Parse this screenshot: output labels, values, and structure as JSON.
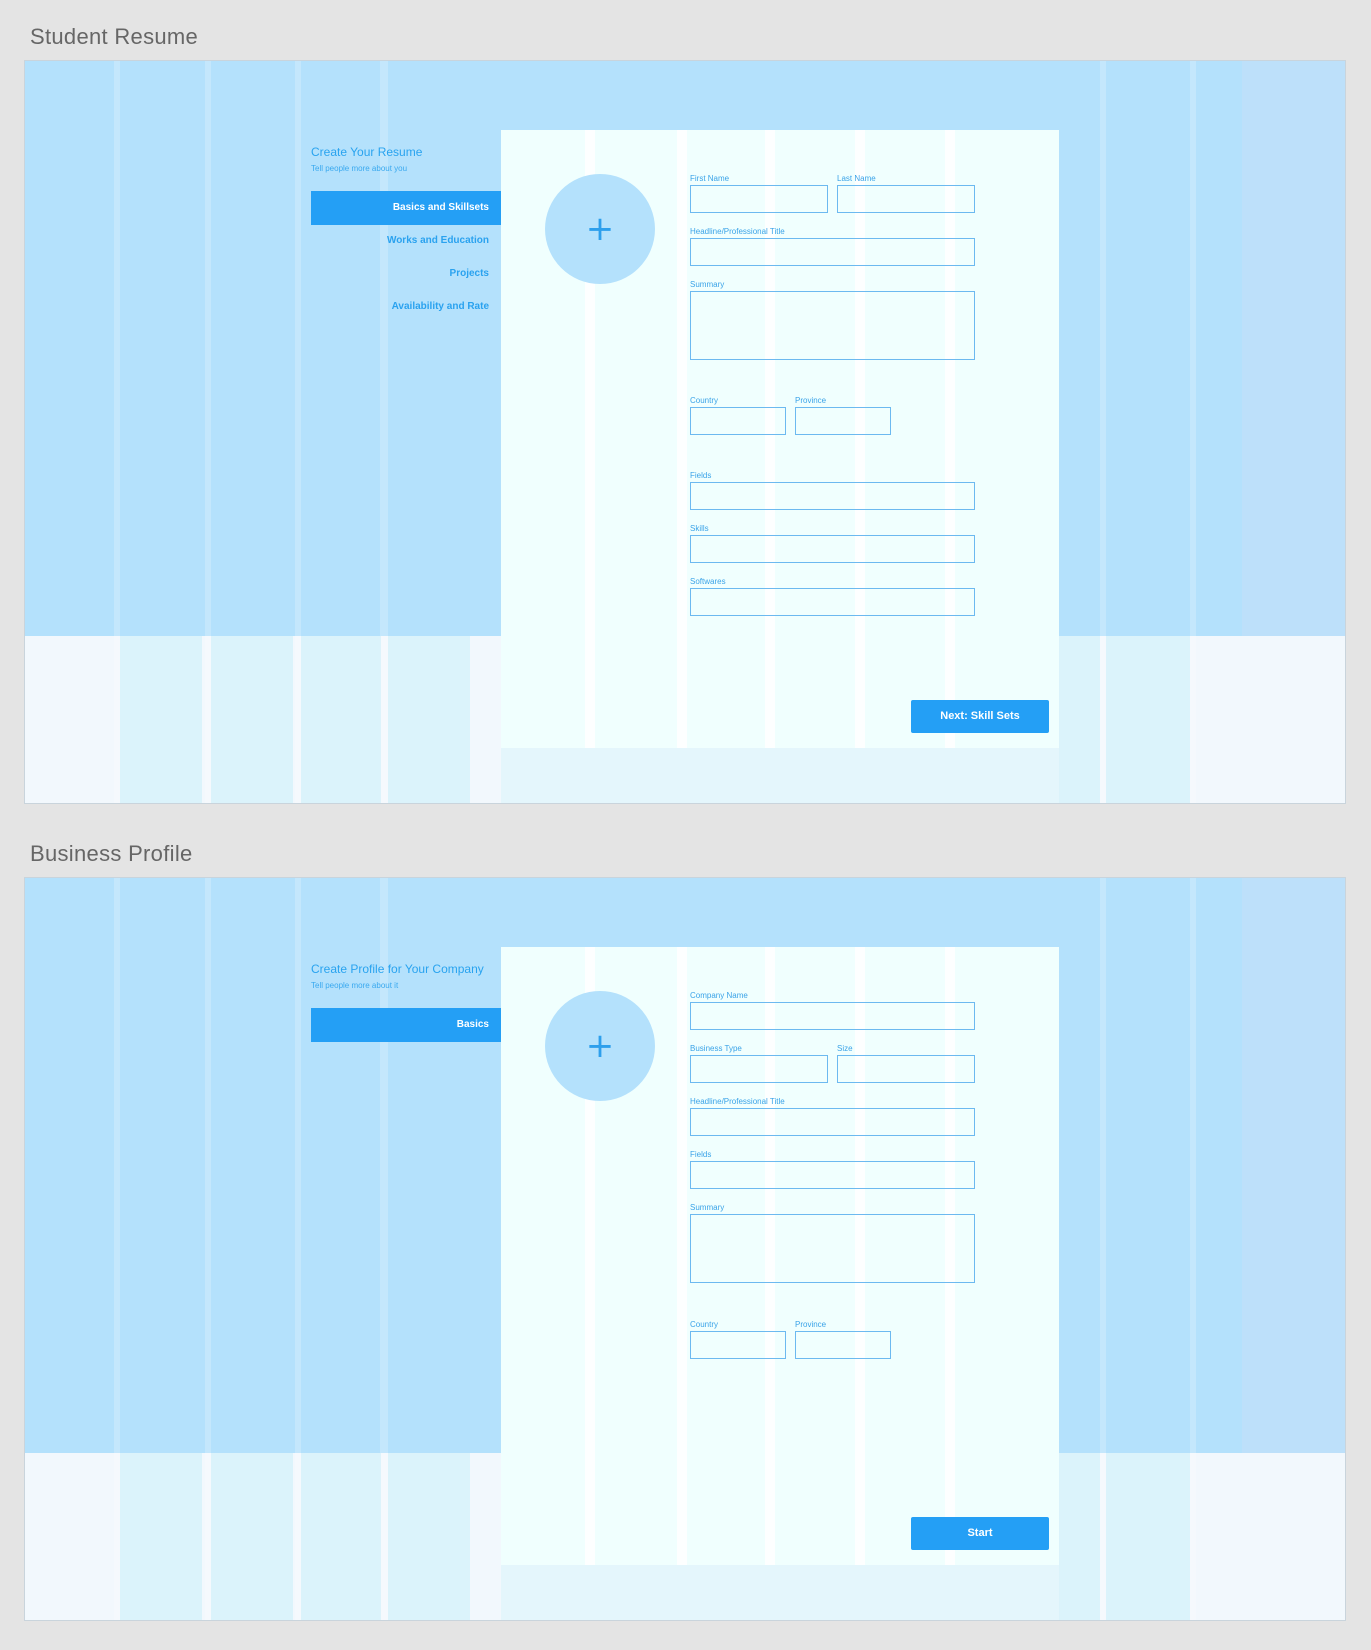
{
  "resume": {
    "board_title": "Student Resume",
    "heading": "Create Your Resume",
    "subheading": "Tell people more about you",
    "nav": [
      {
        "label": "Basics and Skillsets",
        "active": true
      },
      {
        "label": "Works and Education",
        "active": false
      },
      {
        "label": "Projects",
        "active": false
      },
      {
        "label": "Availability and Rate",
        "active": false
      }
    ],
    "avatar_icon": "plus-icon",
    "avatar_glyph": "+",
    "fields": {
      "first_name": "First Name",
      "last_name": "Last Name",
      "headline": "Headline/Professional Title",
      "summary": "Summary",
      "country": "Country",
      "province": "Province",
      "fields": "Fields",
      "skills": "Skills",
      "softwares": "Softwares"
    },
    "next_button": "Next: Skill Sets"
  },
  "business": {
    "board_title": "Business Profile",
    "heading": "Create Profile for Your Company",
    "subheading": "Tell people more about it",
    "nav": [
      {
        "label": "Basics",
        "active": true
      }
    ],
    "avatar_icon": "plus-icon",
    "avatar_glyph": "+",
    "fields": {
      "company_name": "Company Name",
      "business_type": "Business Type",
      "size": "Size",
      "headline": "Headline/Professional Title",
      "fields": "Fields",
      "summary": "Summary",
      "country": "Country",
      "province": "Province"
    },
    "start_button": "Start"
  },
  "colors": {
    "accent": "#249ff5",
    "hero_bg": "#b4e1fc",
    "card_bg": "#f0fffe",
    "field_border": "#6cb9f0",
    "canvas_bg": "#e4e4e4"
  }
}
